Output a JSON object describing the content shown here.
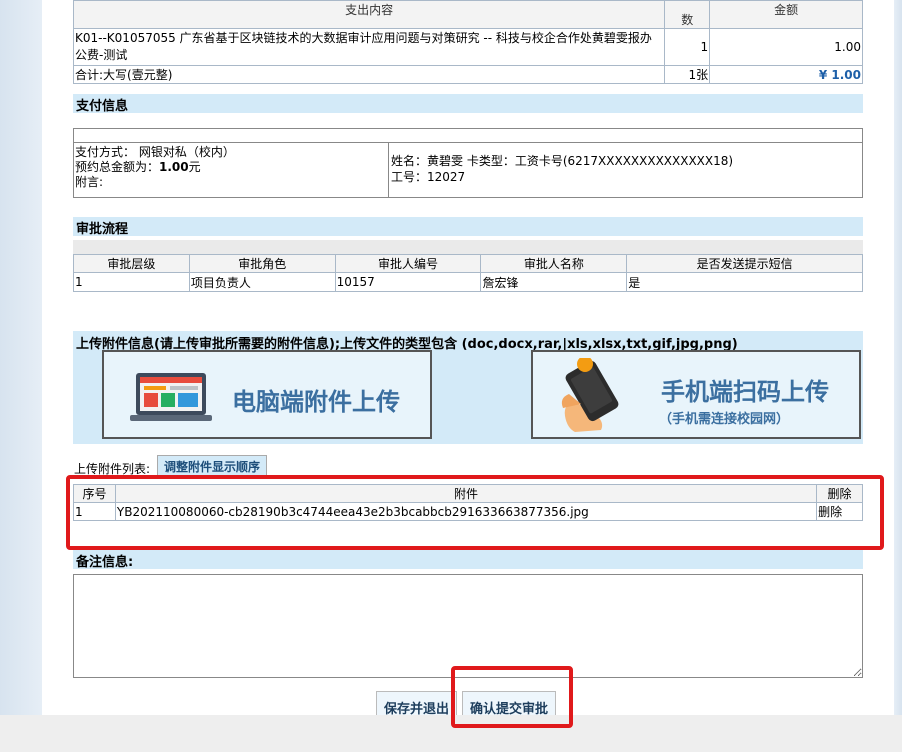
{
  "expense_table": {
    "headers": [
      "支出内容",
      "数",
      "金额"
    ],
    "item": {
      "content": "K01--K01057055 广东省基于区块链技术的大数据审计应用问题与对策研究 -- 科技与校企合作处黄碧雯报办公费-测试",
      "count": "1",
      "amount": "1.00"
    },
    "total": {
      "label": "合计:大写(壹元整)",
      "count": "1张",
      "amount": "¥ 1.00"
    }
  },
  "payment": {
    "section_title": "支付信息",
    "method": "支付方式：  网银对私（校内）",
    "total_label": "预约总金额为：",
    "total_value": "1.00",
    "total_unit": "元",
    "note_label": "附言:",
    "name_line": "姓名：黄碧雯 卡类型：工资卡号(6217XXXXXXXXXXXXXX18)",
    "staff_line": "工号：12027"
  },
  "approval": {
    "section_title": "审批流程",
    "headers": [
      "审批层级",
      "审批角色",
      "审批人编号",
      "审批人名称",
      "是否发送提示短信"
    ],
    "rows": [
      [
        "1",
        "项目负责人",
        "10157",
        "詹宏锋",
        "是"
      ]
    ]
  },
  "upload": {
    "title": "上传附件信息(请上传审批所需要的附件信息);上传文件的类型包含 (doc,docx,rar,|xls,xlsx,txt,gif,jpg,png)",
    "pc_button": "电脑端附件上传",
    "mobile_button": "手机端扫码上传",
    "mobile_note": "（手机需连接校园网）"
  },
  "attachments": {
    "list_label": "上传附件列表:",
    "reorder_button": "调整附件显示顺序",
    "headers": [
      "序号",
      "附件",
      "删除"
    ],
    "rows": [
      [
        "1",
        "YB202110080060-cb28190b3c4744eea43e2b3bcabbcb291633663877356.jpg",
        "删除"
      ]
    ]
  },
  "notes": {
    "title": "备注信息:",
    "value": ""
  },
  "actions": {
    "save_exit": "保存并退出",
    "submit": "确认提交审批"
  },
  "colors": {
    "section_bg": "#d3eaf8",
    "highlight": "#e0191b"
  }
}
